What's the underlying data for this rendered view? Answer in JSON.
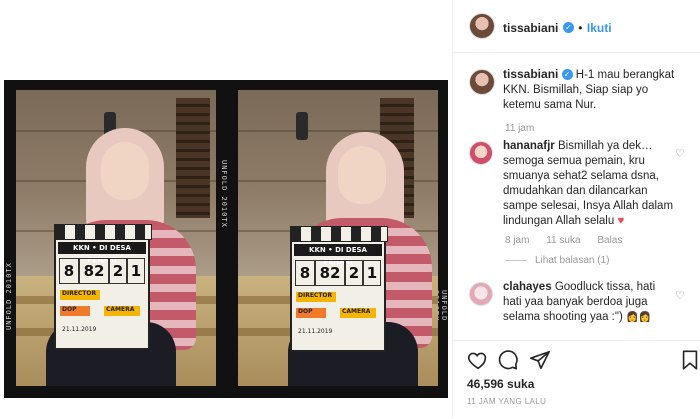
{
  "post": {
    "author": "tissabiani",
    "follow_label": "Ikuti",
    "caption": "H-1 mau berangkat KKN. Bismillah, Siap siap yo ketemu sama Nur.",
    "caption_time": "11 jam",
    "film_edge_text": "UNFOLD 2010TX",
    "clapper": {
      "title": "KKN • DI DESA PENARI",
      "numbers": [
        "8",
        "82",
        "2",
        "1"
      ],
      "roles": [
        "DIRECTOR",
        "DOP",
        "CAMERA"
      ],
      "date": "21.11.2019"
    }
  },
  "comments": [
    {
      "username": "hananafjr",
      "text": "Bismillah ya dek… semoga semua pemain, kru smuanya sehat2 selama dsna, dmudahkan dan dilancarkan sampe selesai, Insya Allah dalam lindungan Allah selalu",
      "emoji": "♥",
      "time": "8 jam",
      "likes": "11 suka",
      "reply": "Balas",
      "view_replies": "Lihat balasan (1)"
    },
    {
      "username": "clahayes",
      "text": "Goodluck tissa, hati hati yaa banyak berdoa juga selama shooting yaa :\")",
      "emoji": "👩‍👩"
    }
  ],
  "actions": {
    "like_icon": "heart-outline-icon",
    "comment_icon": "comment-bubble-icon",
    "share_icon": "paper-plane-icon",
    "save_icon": "bookmark-icon",
    "likes_count": "46,596 suka",
    "timestamp": "11 JAM YANG LALU"
  },
  "colors": {
    "link_blue": "#3897f0",
    "heart_red": "#ed4956",
    "muted": "#999999"
  }
}
